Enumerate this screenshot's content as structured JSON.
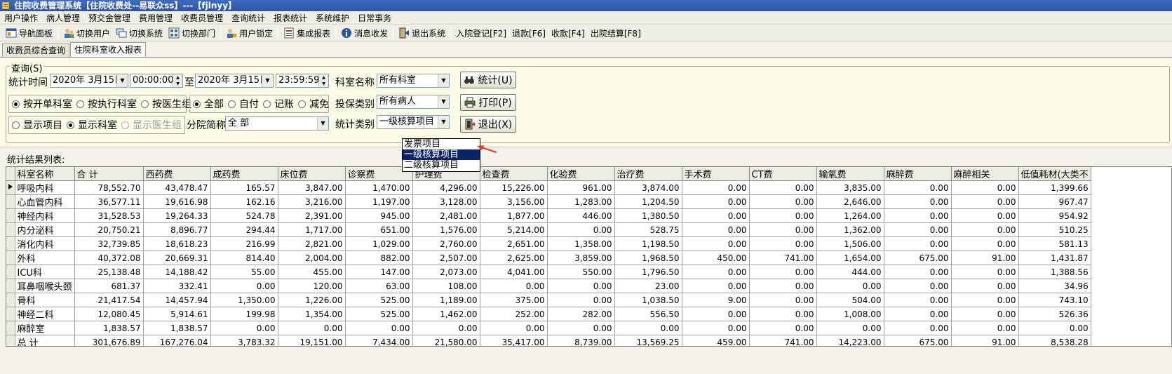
{
  "window": {
    "title": "住院收费管理系统【住院收费处--易联众ss】---【fjlnyy】"
  },
  "menu": [
    "用户操作",
    "病人管理",
    "预交金管理",
    "费用管理",
    "收费员管理",
    "查询统计",
    "报表统计",
    "系统维护",
    "日常事务"
  ],
  "toolbar": [
    {
      "label": "导航面板",
      "icon": "navigation-panel-icon"
    },
    {
      "label": "切换用户",
      "icon": "switch-user-icon"
    },
    {
      "label": "切换系统",
      "icon": "switch-system-icon"
    },
    {
      "label": "切换部门",
      "icon": "switch-department-icon"
    },
    {
      "label": "用户锁定",
      "icon": "user-lock-icon"
    },
    {
      "label": "集成报表",
      "icon": "integrated-report-icon"
    },
    {
      "label": "消息收发",
      "icon": "message-icon"
    },
    {
      "label": "退出系统",
      "icon": "exit-system-icon"
    },
    {
      "label": "入院登记[F2]"
    },
    {
      "label": "退款[F6]"
    },
    {
      "label": "收款[F4]"
    },
    {
      "label": "出院结算[F8]"
    }
  ],
  "tabs": [
    "收费员综合查询",
    "住院科室收入报表"
  ],
  "query": {
    "group_title": "查询(S)",
    "time_label": "统计时间",
    "start_date": "2020年 3月15日",
    "start_time": "00:00:00",
    "to_label": "至",
    "end_date": "2020年 3月15日",
    "end_time": "23:59:59",
    "dept_label": "科室名称",
    "dept_value": "所有科室",
    "insurance_label": "投保类别",
    "insurance_value": "所有病人",
    "stat_type_label": "统计类别",
    "stat_type_value": "一级核算项目",
    "stat_type_options": [
      "发票项目",
      "一级核算项目",
      "二级核算项目"
    ],
    "stat_type_selected_index": 1,
    "dept_mode_radios": [
      "按开单科室",
      "按执行科室",
      "按医生组"
    ],
    "dept_mode_selected": 0,
    "fee_radios": [
      "全部",
      "自付",
      "记账",
      "减免"
    ],
    "fee_selected": 0,
    "display_radios": [
      "显示项目",
      "显示科室",
      "显示医生组"
    ],
    "display_selected": 1,
    "hospital_label": "分院简称",
    "hospital_value": "全 部",
    "buttons": {
      "stat": "统计(U)",
      "print": "打印(P)",
      "exit": "退出(X)"
    }
  },
  "result_label": "统计结果列表:",
  "table": {
    "columns": [
      "科室名称",
      "合 计",
      "西药费",
      "成药费",
      "床位费",
      "诊察费",
      "护理费",
      "检查费",
      "化验费",
      "治疗费",
      "手术费",
      "CT费",
      "输氧费",
      "麻醉费",
      "麻醉相关",
      "低值耗材(大类不"
    ],
    "rows": [
      [
        "呼吸内科",
        "78,552.70",
        "43,478.47",
        "165.57",
        "3,847.00",
        "1,470.00",
        "4,296.00",
        "15,226.00",
        "961.00",
        "3,874.00",
        "0.00",
        "0.00",
        "3,835.00",
        "0.00",
        "0.00",
        "1,399.66"
      ],
      [
        "心血管内科",
        "36,577.11",
        "19,616.98",
        "162.16",
        "3,216.00",
        "1,197.00",
        "3,128.00",
        "3,156.00",
        "1,283.00",
        "1,204.50",
        "0.00",
        "0.00",
        "2,646.00",
        "0.00",
        "0.00",
        "967.47"
      ],
      [
        "神经内科",
        "31,528.53",
        "19,264.33",
        "524.78",
        "2,391.00",
        "945.00",
        "2,481.00",
        "1,877.00",
        "446.00",
        "1,380.50",
        "0.00",
        "0.00",
        "1,264.00",
        "0.00",
        "0.00",
        "954.92"
      ],
      [
        "内分泌科",
        "20,750.21",
        "8,896.77",
        "294.44",
        "1,717.00",
        "651.00",
        "1,576.00",
        "5,214.00",
        "0.00",
        "528.75",
        "0.00",
        "0.00",
        "1,362.00",
        "0.00",
        "0.00",
        "510.25"
      ],
      [
        "消化内科",
        "32,739.85",
        "18,618.23",
        "216.99",
        "2,821.00",
        "1,029.00",
        "2,760.00",
        "2,651.00",
        "1,358.00",
        "1,198.50",
        "0.00",
        "0.00",
        "1,506.00",
        "0.00",
        "0.00",
        "581.13"
      ],
      [
        "外科",
        "40,372.08",
        "20,669.31",
        "814.40",
        "2,004.00",
        "882.00",
        "2,507.00",
        "2,625.00",
        "3,859.00",
        "1,968.50",
        "450.00",
        "741.00",
        "1,654.00",
        "675.00",
        "91.00",
        "1,431.87"
      ],
      [
        "ICU科",
        "25,138.48",
        "14,188.42",
        "55.00",
        "455.00",
        "147.00",
        "2,073.00",
        "4,041.00",
        "550.00",
        "1,796.50",
        "0.00",
        "0.00",
        "444.00",
        "0.00",
        "0.00",
        "1,388.56"
      ],
      [
        "耳鼻咽喉头颈",
        "681.37",
        "332.41",
        "0.00",
        "120.00",
        "63.00",
        "108.00",
        "0.00",
        "0.00",
        "23.00",
        "0.00",
        "0.00",
        "0.00",
        "0.00",
        "0.00",
        "34.96"
      ],
      [
        "骨科",
        "21,417.54",
        "14,457.94",
        "1,350.00",
        "1,226.00",
        "525.00",
        "1,189.00",
        "375.00",
        "0.00",
        "1,038.50",
        "9.00",
        "0.00",
        "504.00",
        "0.00",
        "0.00",
        "743.10"
      ],
      [
        "神经二科",
        "12,080.45",
        "5,914.61",
        "199.98",
        "1,354.00",
        "525.00",
        "1,462.00",
        "252.00",
        "282.00",
        "556.50",
        "0.00",
        "0.00",
        "1,008.00",
        "0.00",
        "0.00",
        "526.36"
      ],
      [
        "麻醉室",
        "1,838.57",
        "1,838.57",
        "0.00",
        "0.00",
        "0.00",
        "0.00",
        "0.00",
        "0.00",
        "0.00",
        "0.00",
        "0.00",
        "0.00",
        "0.00",
        "0.00",
        "0.00"
      ],
      [
        "总 计",
        "301,676.89",
        "167,276.04",
        "3,783.32",
        "19,151.00",
        "7,434.00",
        "21,580.00",
        "35,417.00",
        "8,739.00",
        "13,569.25",
        "459.00",
        "741.00",
        "14,223.00",
        "675.00",
        "91.00",
        "8,538.28"
      ]
    ]
  },
  "colors": {
    "title_bar": "#2b55a8",
    "query_bg": "#fbfbe6",
    "selected_option": "#0a246a",
    "annotation_arrow": "#e8372b"
  }
}
